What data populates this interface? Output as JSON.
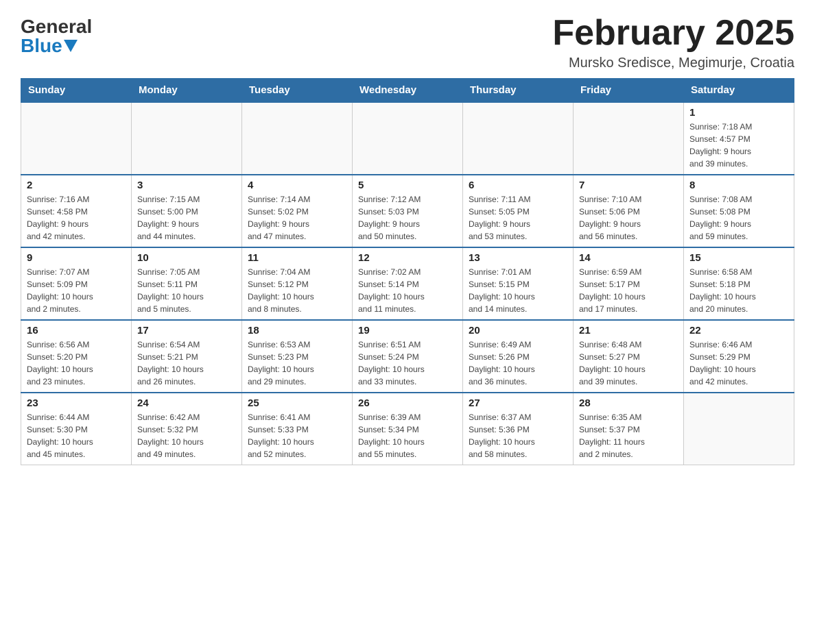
{
  "header": {
    "logo_general": "General",
    "logo_blue": "Blue",
    "month_title": "February 2025",
    "location": "Mursko Sredisce, Megimurje, Croatia"
  },
  "days_of_week": [
    "Sunday",
    "Monday",
    "Tuesday",
    "Wednesday",
    "Thursday",
    "Friday",
    "Saturday"
  ],
  "weeks": [
    {
      "days": [
        {
          "number": "",
          "info": ""
        },
        {
          "number": "",
          "info": ""
        },
        {
          "number": "",
          "info": ""
        },
        {
          "number": "",
          "info": ""
        },
        {
          "number": "",
          "info": ""
        },
        {
          "number": "",
          "info": ""
        },
        {
          "number": "1",
          "info": "Sunrise: 7:18 AM\nSunset: 4:57 PM\nDaylight: 9 hours\nand 39 minutes."
        }
      ]
    },
    {
      "days": [
        {
          "number": "2",
          "info": "Sunrise: 7:16 AM\nSunset: 4:58 PM\nDaylight: 9 hours\nand 42 minutes."
        },
        {
          "number": "3",
          "info": "Sunrise: 7:15 AM\nSunset: 5:00 PM\nDaylight: 9 hours\nand 44 minutes."
        },
        {
          "number": "4",
          "info": "Sunrise: 7:14 AM\nSunset: 5:02 PM\nDaylight: 9 hours\nand 47 minutes."
        },
        {
          "number": "5",
          "info": "Sunrise: 7:12 AM\nSunset: 5:03 PM\nDaylight: 9 hours\nand 50 minutes."
        },
        {
          "number": "6",
          "info": "Sunrise: 7:11 AM\nSunset: 5:05 PM\nDaylight: 9 hours\nand 53 minutes."
        },
        {
          "number": "7",
          "info": "Sunrise: 7:10 AM\nSunset: 5:06 PM\nDaylight: 9 hours\nand 56 minutes."
        },
        {
          "number": "8",
          "info": "Sunrise: 7:08 AM\nSunset: 5:08 PM\nDaylight: 9 hours\nand 59 minutes."
        }
      ]
    },
    {
      "days": [
        {
          "number": "9",
          "info": "Sunrise: 7:07 AM\nSunset: 5:09 PM\nDaylight: 10 hours\nand 2 minutes."
        },
        {
          "number": "10",
          "info": "Sunrise: 7:05 AM\nSunset: 5:11 PM\nDaylight: 10 hours\nand 5 minutes."
        },
        {
          "number": "11",
          "info": "Sunrise: 7:04 AM\nSunset: 5:12 PM\nDaylight: 10 hours\nand 8 minutes."
        },
        {
          "number": "12",
          "info": "Sunrise: 7:02 AM\nSunset: 5:14 PM\nDaylight: 10 hours\nand 11 minutes."
        },
        {
          "number": "13",
          "info": "Sunrise: 7:01 AM\nSunset: 5:15 PM\nDaylight: 10 hours\nand 14 minutes."
        },
        {
          "number": "14",
          "info": "Sunrise: 6:59 AM\nSunset: 5:17 PM\nDaylight: 10 hours\nand 17 minutes."
        },
        {
          "number": "15",
          "info": "Sunrise: 6:58 AM\nSunset: 5:18 PM\nDaylight: 10 hours\nand 20 minutes."
        }
      ]
    },
    {
      "days": [
        {
          "number": "16",
          "info": "Sunrise: 6:56 AM\nSunset: 5:20 PM\nDaylight: 10 hours\nand 23 minutes."
        },
        {
          "number": "17",
          "info": "Sunrise: 6:54 AM\nSunset: 5:21 PM\nDaylight: 10 hours\nand 26 minutes."
        },
        {
          "number": "18",
          "info": "Sunrise: 6:53 AM\nSunset: 5:23 PM\nDaylight: 10 hours\nand 29 minutes."
        },
        {
          "number": "19",
          "info": "Sunrise: 6:51 AM\nSunset: 5:24 PM\nDaylight: 10 hours\nand 33 minutes."
        },
        {
          "number": "20",
          "info": "Sunrise: 6:49 AM\nSunset: 5:26 PM\nDaylight: 10 hours\nand 36 minutes."
        },
        {
          "number": "21",
          "info": "Sunrise: 6:48 AM\nSunset: 5:27 PM\nDaylight: 10 hours\nand 39 minutes."
        },
        {
          "number": "22",
          "info": "Sunrise: 6:46 AM\nSunset: 5:29 PM\nDaylight: 10 hours\nand 42 minutes."
        }
      ]
    },
    {
      "days": [
        {
          "number": "23",
          "info": "Sunrise: 6:44 AM\nSunset: 5:30 PM\nDaylight: 10 hours\nand 45 minutes."
        },
        {
          "number": "24",
          "info": "Sunrise: 6:42 AM\nSunset: 5:32 PM\nDaylight: 10 hours\nand 49 minutes."
        },
        {
          "number": "25",
          "info": "Sunrise: 6:41 AM\nSunset: 5:33 PM\nDaylight: 10 hours\nand 52 minutes."
        },
        {
          "number": "26",
          "info": "Sunrise: 6:39 AM\nSunset: 5:34 PM\nDaylight: 10 hours\nand 55 minutes."
        },
        {
          "number": "27",
          "info": "Sunrise: 6:37 AM\nSunset: 5:36 PM\nDaylight: 10 hours\nand 58 minutes."
        },
        {
          "number": "28",
          "info": "Sunrise: 6:35 AM\nSunset: 5:37 PM\nDaylight: 11 hours\nand 2 minutes."
        },
        {
          "number": "",
          "info": ""
        }
      ]
    }
  ]
}
